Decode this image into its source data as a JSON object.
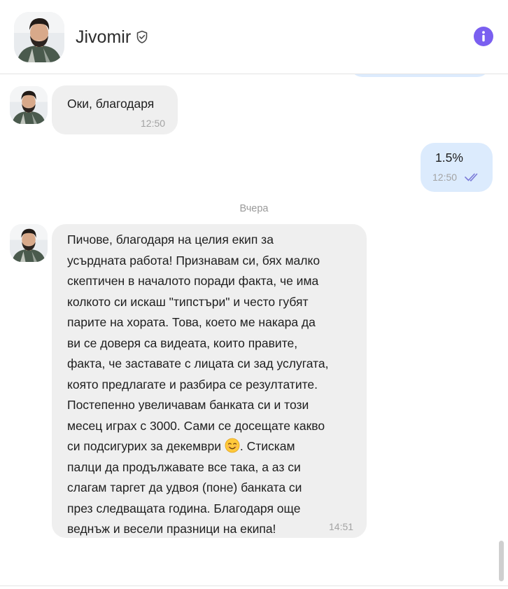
{
  "header": {
    "contact_name": "Jivomir",
    "verified_icon": "shield-check-icon",
    "info_icon": "info-icon"
  },
  "messages": [
    {
      "direction": "incoming",
      "text": "Оки, благодаря",
      "time": "12:50"
    },
    {
      "direction": "outgoing",
      "text": "1.5%",
      "time": "12:50",
      "status": "read"
    },
    {
      "direction": "incoming",
      "text_before_emoji": "Пичове, благодаря на целия екип за\nусърдната работа! Признавам си, бях малко\nскептичен в началото поради факта, че има\nколкото си искаш \"типстъри\" и често губят\nпарите на хората. Това, което ме накара да\nви се доверя са видеата, които правите,\nфакта, че заставате с лицата си зад услугата,\nкоято предлагате и разбира се резултатите.\nПостепенно увеличавам банката си и този\nмесец играх с 3000. Сами се досещате какво\nси подсигурих за декември ",
      "emoji": "smiling-face-emoji",
      "text_after_emoji": ". Стискам\nпалци да продължавате все така, а аз си\nслагам таргет да удвоя (поне) банката си\nпрез следващата година. Благодаря още\nведнъж и весели празници на екипа!",
      "time": "14:51"
    }
  ],
  "date_divider": "Вчера",
  "colors": {
    "accent": "#7a5ff0",
    "incoming_bubble": "#efefef",
    "outgoing_bubble": "#dcebfd",
    "read_ticks": "#7a7ad8",
    "timestamp": "#a3a3a3"
  }
}
